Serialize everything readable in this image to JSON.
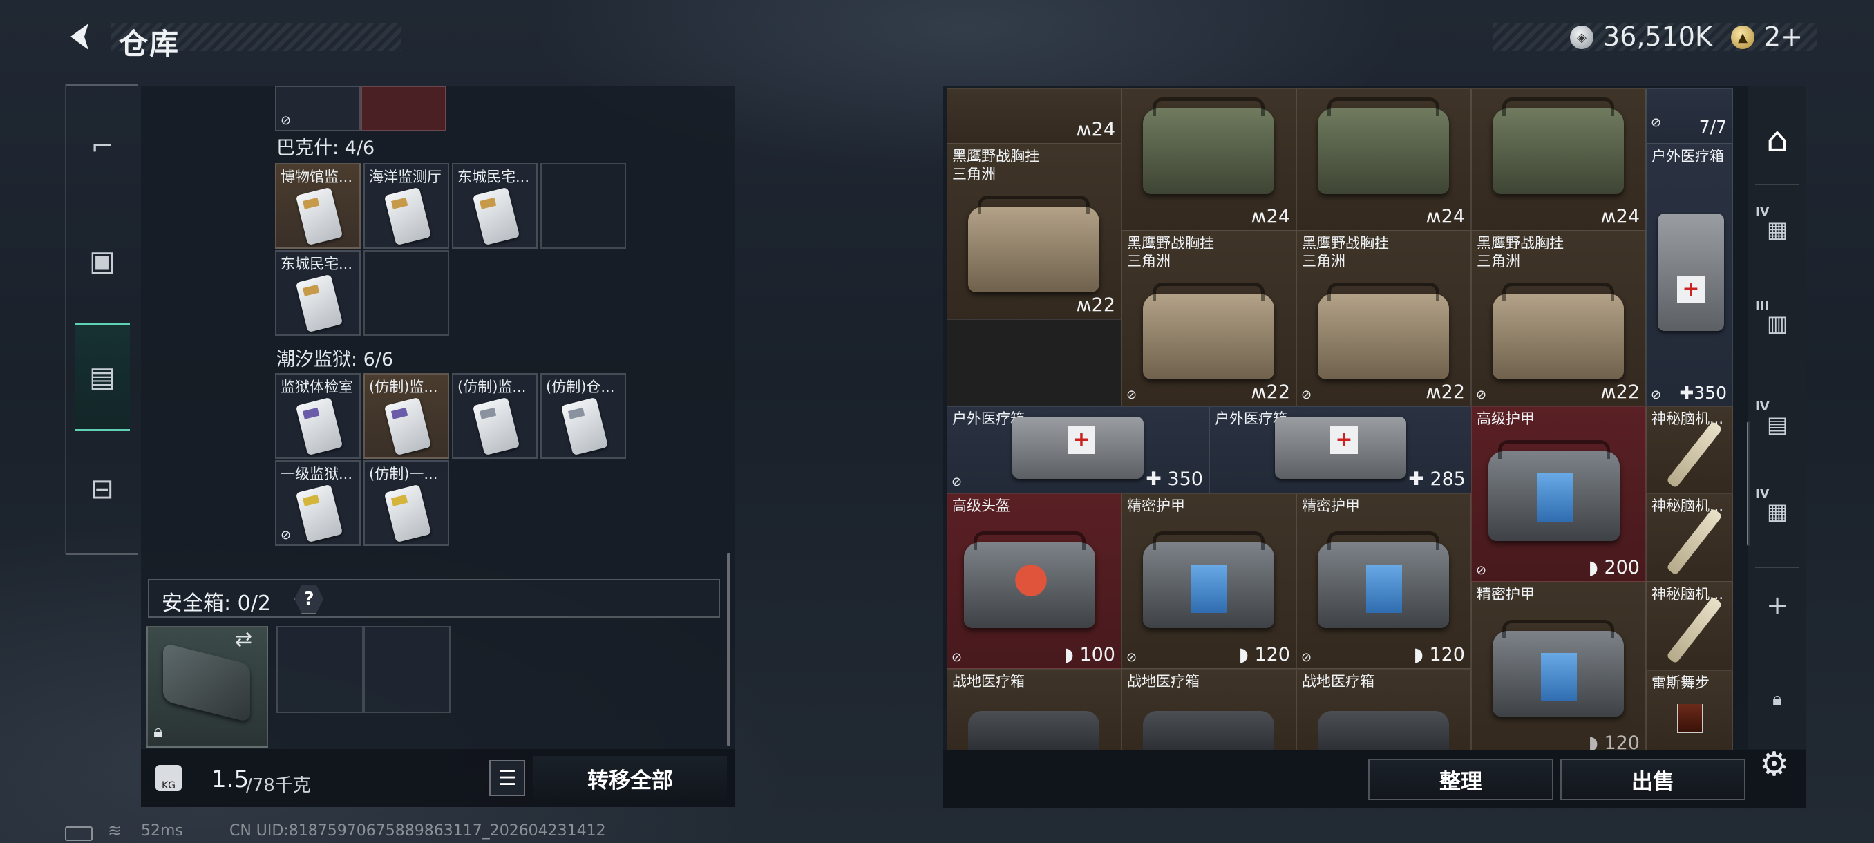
{
  "header": {
    "title": "仓库",
    "silver_amount": "36,510K",
    "gold_amount": "2+"
  },
  "left_tabs": [
    "firearms-tab",
    "armor-tab",
    "backpack-tab",
    "toolbox-tab"
  ],
  "backpack": {
    "groups": [
      {
        "title": "巴克什: 4/6",
        "items": [
          "博物馆监...",
          "海洋监测厅",
          "东城民宅...",
          "东城民宅..."
        ]
      },
      {
        "title": "潮汐监狱: 6/6",
        "items": [
          "监狱体检室",
          "(仿制)监...",
          "(仿制)监...",
          "(仿制)仓...",
          "一级监狱...",
          "(仿制)一..."
        ]
      }
    ],
    "safebox_label": "安全箱: 0/2",
    "help": "?",
    "weight_value": "1.5",
    "weight_max": "/78千克",
    "transfer_all": "转移全部"
  },
  "stash": {
    "top_counts": [
      "24",
      "24",
      "24",
      "24"
    ],
    "count_7_7": "7/7",
    "items": {
      "rig_a_name": "黑鹰野战胸挂\n三角洲",
      "rig_a_value": "22",
      "rig_b_name": "黑鹰野战胸挂\n三角洲",
      "rig_b_value": "22",
      "rig_c_name": "黑鹰野战胸挂\n三角洲",
      "rig_c_value": "22",
      "rig_d_name": "黑鹰野战胸挂\n三角洲",
      "rig_d_value": "22",
      "outdoor_med_tall": "户外医疗箱",
      "outdoor_med_tall_value": "350",
      "outdoor_med_1": "户外医疗箱",
      "outdoor_med_1_value": "350",
      "outdoor_med_2": "户外医疗箱",
      "outdoor_med_2_value": "285",
      "adv_armor": "高级护甲",
      "adv_armor_value": "200",
      "adv_helmet": "高级头盔",
      "adv_helmet_value": "100",
      "precise_armor_1": "精密护甲",
      "precise_armor_1_value": "120",
      "precise_armor_2": "精密护甲",
      "precise_armor_2_value": "120",
      "precise_armor_3": "精密护甲",
      "precise_armor_3_value": "120",
      "brain_1": "神秘脑机...",
      "brain_2": "神秘脑机...",
      "brain_3": "神秘脑机...",
      "rhys_dance": "雷斯舞步",
      "field_med_1": "战地医疗箱",
      "field_med_2": "战地医疗箱",
      "field_med_3": "战地医疗箱"
    },
    "sort_label": "整理",
    "sell_label": "出售"
  },
  "right_tabs": {
    "tier4a": "IV",
    "tier3": "III",
    "tier4b": "IV",
    "tier4c": "IV",
    "add": "+"
  },
  "status": {
    "ping": "52ms",
    "uid": "CN UID:8187597067588986311​7_202604231412"
  }
}
